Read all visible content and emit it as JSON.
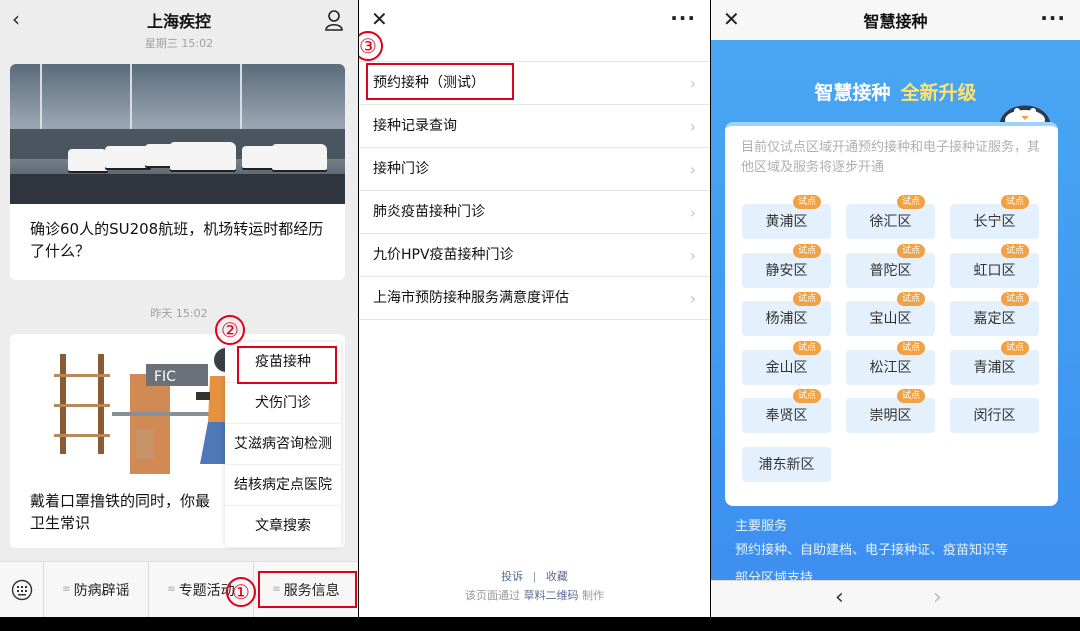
{
  "panel1": {
    "title": "上海疾控",
    "back_icon": "‹",
    "profile_icon": "person-icon",
    "timestamp_top": "星期三 15:02",
    "article1_title": "确诊60人的SU208航班，机场转运时都经历了什么？",
    "timestamp_mid": "昨天 15:02",
    "illus_sign": "FIC",
    "article2_title": "戴着口罩撸铁的同时，你最",
    "article2_title_2": "卫生常识",
    "menu": [
      "疫苗接种",
      "犬伤门诊",
      "艾滋病咨询检测",
      "结核病定点医院",
      "文章搜索"
    ],
    "bottom_tabs": [
      "防病辟谣",
      "专题活动",
      "服务信息"
    ],
    "markers": [
      "①",
      "②"
    ]
  },
  "panel2": {
    "close_icon": "✕",
    "more_icon": "···",
    "marker": "③",
    "items": [
      "预约接种（测试）",
      "接种记录查询",
      "接种门诊",
      "肺炎疫苗接种门诊",
      "九价HPV疫苗接种门诊",
      "上海市预防接种服务满意度评估"
    ],
    "footer_complain": "投诉",
    "footer_sep": "|",
    "footer_fav": "收藏",
    "footer_made_prefix": "该页面通过",
    "footer_made_link": "草料二维码",
    "footer_made_suffix": "制作"
  },
  "panel3": {
    "title": "智慧接种",
    "close_icon": "✕",
    "more_icon": "···",
    "hero_main": "智慧接种",
    "hero_accent": "全新升级",
    "notice": "目前仅试点区域开通预约接种和电子接种证服务，其他区域及服务将逐步开通",
    "tag_label": "试点",
    "districts": [
      {
        "name": "黄浦区",
        "pilot": true
      },
      {
        "name": "徐汇区",
        "pilot": true
      },
      {
        "name": "长宁区",
        "pilot": true
      },
      {
        "name": "静安区",
        "pilot": true
      },
      {
        "name": "普陀区",
        "pilot": true
      },
      {
        "name": "虹口区",
        "pilot": true
      },
      {
        "name": "杨浦区",
        "pilot": true
      },
      {
        "name": "宝山区",
        "pilot": true
      },
      {
        "name": "嘉定区",
        "pilot": true
      },
      {
        "name": "金山区",
        "pilot": true
      },
      {
        "name": "松江区",
        "pilot": true
      },
      {
        "name": "青浦区",
        "pilot": true
      },
      {
        "name": "奉贤区",
        "pilot": true
      },
      {
        "name": "崇明区",
        "pilot": true
      },
      {
        "name": "闵行区",
        "pilot": false
      },
      {
        "name": "浦东新区",
        "pilot": false
      }
    ],
    "services_heading": "主要服务",
    "services_desc": "预约接种、自助建档、电子接种证、疫苗知识等",
    "services_more": "部分区域支持",
    "nav_back": "‹",
    "nav_forward": "›"
  },
  "colors": {
    "highlight_red": "#e0001a",
    "brand_blue": "#3d8ff0",
    "pilot_tag": "#f0a346",
    "hero_accent": "#ffe36d"
  }
}
